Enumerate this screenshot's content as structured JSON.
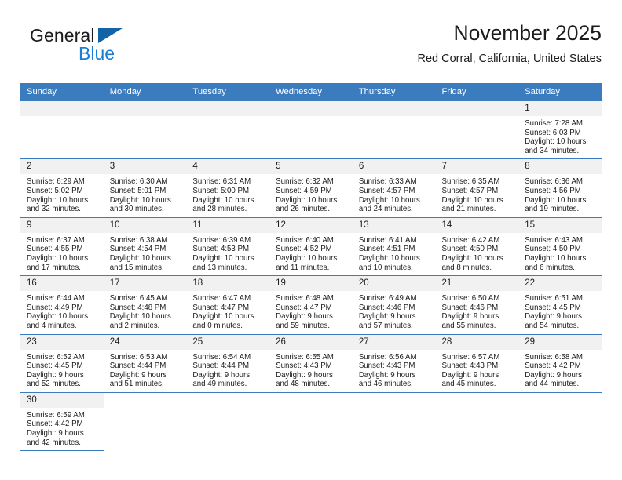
{
  "brand": {
    "word_one": "General",
    "word_two": "Blue",
    "triangle_icon": "blue-triangle-icon",
    "colors": {
      "general": "#1b1b1b",
      "blue": "#1a7fd4",
      "triangle": "#1464a5"
    }
  },
  "header": {
    "title": "November 2025",
    "subtitle": "Red Corral, California, United States"
  },
  "theme": {
    "header_row_bg": "#3b7cbf",
    "daynum_bg": "#f1f1f1",
    "row_rule": "#3b7cbf",
    "text": "#1b1b1b"
  },
  "columns": [
    "Sunday",
    "Monday",
    "Tuesday",
    "Wednesday",
    "Thursday",
    "Friday",
    "Saturday"
  ],
  "weeks": [
    [
      {
        "day": "",
        "lines": []
      },
      {
        "day": "",
        "lines": []
      },
      {
        "day": "",
        "lines": []
      },
      {
        "day": "",
        "lines": []
      },
      {
        "day": "",
        "lines": []
      },
      {
        "day": "",
        "lines": []
      },
      {
        "day": "1",
        "lines": [
          "Sunrise: 7:28 AM",
          "Sunset: 6:03 PM",
          "Daylight: 10 hours",
          "and 34 minutes."
        ]
      }
    ],
    [
      {
        "day": "2",
        "lines": [
          "Sunrise: 6:29 AM",
          "Sunset: 5:02 PM",
          "Daylight: 10 hours",
          "and 32 minutes."
        ]
      },
      {
        "day": "3",
        "lines": [
          "Sunrise: 6:30 AM",
          "Sunset: 5:01 PM",
          "Daylight: 10 hours",
          "and 30 minutes."
        ]
      },
      {
        "day": "4",
        "lines": [
          "Sunrise: 6:31 AM",
          "Sunset: 5:00 PM",
          "Daylight: 10 hours",
          "and 28 minutes."
        ]
      },
      {
        "day": "5",
        "lines": [
          "Sunrise: 6:32 AM",
          "Sunset: 4:59 PM",
          "Daylight: 10 hours",
          "and 26 minutes."
        ]
      },
      {
        "day": "6",
        "lines": [
          "Sunrise: 6:33 AM",
          "Sunset: 4:57 PM",
          "Daylight: 10 hours",
          "and 24 minutes."
        ]
      },
      {
        "day": "7",
        "lines": [
          "Sunrise: 6:35 AM",
          "Sunset: 4:57 PM",
          "Daylight: 10 hours",
          "and 21 minutes."
        ]
      },
      {
        "day": "8",
        "lines": [
          "Sunrise: 6:36 AM",
          "Sunset: 4:56 PM",
          "Daylight: 10 hours",
          "and 19 minutes."
        ]
      }
    ],
    [
      {
        "day": "9",
        "lines": [
          "Sunrise: 6:37 AM",
          "Sunset: 4:55 PM",
          "Daylight: 10 hours",
          "and 17 minutes."
        ]
      },
      {
        "day": "10",
        "lines": [
          "Sunrise: 6:38 AM",
          "Sunset: 4:54 PM",
          "Daylight: 10 hours",
          "and 15 minutes."
        ]
      },
      {
        "day": "11",
        "lines": [
          "Sunrise: 6:39 AM",
          "Sunset: 4:53 PM",
          "Daylight: 10 hours",
          "and 13 minutes."
        ]
      },
      {
        "day": "12",
        "lines": [
          "Sunrise: 6:40 AM",
          "Sunset: 4:52 PM",
          "Daylight: 10 hours",
          "and 11 minutes."
        ]
      },
      {
        "day": "13",
        "lines": [
          "Sunrise: 6:41 AM",
          "Sunset: 4:51 PM",
          "Daylight: 10 hours",
          "and 10 minutes."
        ]
      },
      {
        "day": "14",
        "lines": [
          "Sunrise: 6:42 AM",
          "Sunset: 4:50 PM",
          "Daylight: 10 hours",
          "and 8 minutes."
        ]
      },
      {
        "day": "15",
        "lines": [
          "Sunrise: 6:43 AM",
          "Sunset: 4:50 PM",
          "Daylight: 10 hours",
          "and 6 minutes."
        ]
      }
    ],
    [
      {
        "day": "16",
        "lines": [
          "Sunrise: 6:44 AM",
          "Sunset: 4:49 PM",
          "Daylight: 10 hours",
          "and 4 minutes."
        ]
      },
      {
        "day": "17",
        "lines": [
          "Sunrise: 6:45 AM",
          "Sunset: 4:48 PM",
          "Daylight: 10 hours",
          "and 2 minutes."
        ]
      },
      {
        "day": "18",
        "lines": [
          "Sunrise: 6:47 AM",
          "Sunset: 4:47 PM",
          "Daylight: 10 hours",
          "and 0 minutes."
        ]
      },
      {
        "day": "19",
        "lines": [
          "Sunrise: 6:48 AM",
          "Sunset: 4:47 PM",
          "Daylight: 9 hours",
          "and 59 minutes."
        ]
      },
      {
        "day": "20",
        "lines": [
          "Sunrise: 6:49 AM",
          "Sunset: 4:46 PM",
          "Daylight: 9 hours",
          "and 57 minutes."
        ]
      },
      {
        "day": "21",
        "lines": [
          "Sunrise: 6:50 AM",
          "Sunset: 4:46 PM",
          "Daylight: 9 hours",
          "and 55 minutes."
        ]
      },
      {
        "day": "22",
        "lines": [
          "Sunrise: 6:51 AM",
          "Sunset: 4:45 PM",
          "Daylight: 9 hours",
          "and 54 minutes."
        ]
      }
    ],
    [
      {
        "day": "23",
        "lines": [
          "Sunrise: 6:52 AM",
          "Sunset: 4:45 PM",
          "Daylight: 9 hours",
          "and 52 minutes."
        ]
      },
      {
        "day": "24",
        "lines": [
          "Sunrise: 6:53 AM",
          "Sunset: 4:44 PM",
          "Daylight: 9 hours",
          "and 51 minutes."
        ]
      },
      {
        "day": "25",
        "lines": [
          "Sunrise: 6:54 AM",
          "Sunset: 4:44 PM",
          "Daylight: 9 hours",
          "and 49 minutes."
        ]
      },
      {
        "day": "26",
        "lines": [
          "Sunrise: 6:55 AM",
          "Sunset: 4:43 PM",
          "Daylight: 9 hours",
          "and 48 minutes."
        ]
      },
      {
        "day": "27",
        "lines": [
          "Sunrise: 6:56 AM",
          "Sunset: 4:43 PM",
          "Daylight: 9 hours",
          "and 46 minutes."
        ]
      },
      {
        "day": "28",
        "lines": [
          "Sunrise: 6:57 AM",
          "Sunset: 4:43 PM",
          "Daylight: 9 hours",
          "and 45 minutes."
        ]
      },
      {
        "day": "29",
        "lines": [
          "Sunrise: 6:58 AM",
          "Sunset: 4:42 PM",
          "Daylight: 9 hours",
          "and 44 minutes."
        ]
      }
    ],
    [
      {
        "day": "30",
        "lines": [
          "Sunrise: 6:59 AM",
          "Sunset: 4:42 PM",
          "Daylight: 9 hours",
          "and 42 minutes."
        ]
      },
      {
        "day": "",
        "lines": []
      },
      {
        "day": "",
        "lines": []
      },
      {
        "day": "",
        "lines": []
      },
      {
        "day": "",
        "lines": []
      },
      {
        "day": "",
        "lines": []
      },
      {
        "day": "",
        "lines": []
      }
    ]
  ]
}
